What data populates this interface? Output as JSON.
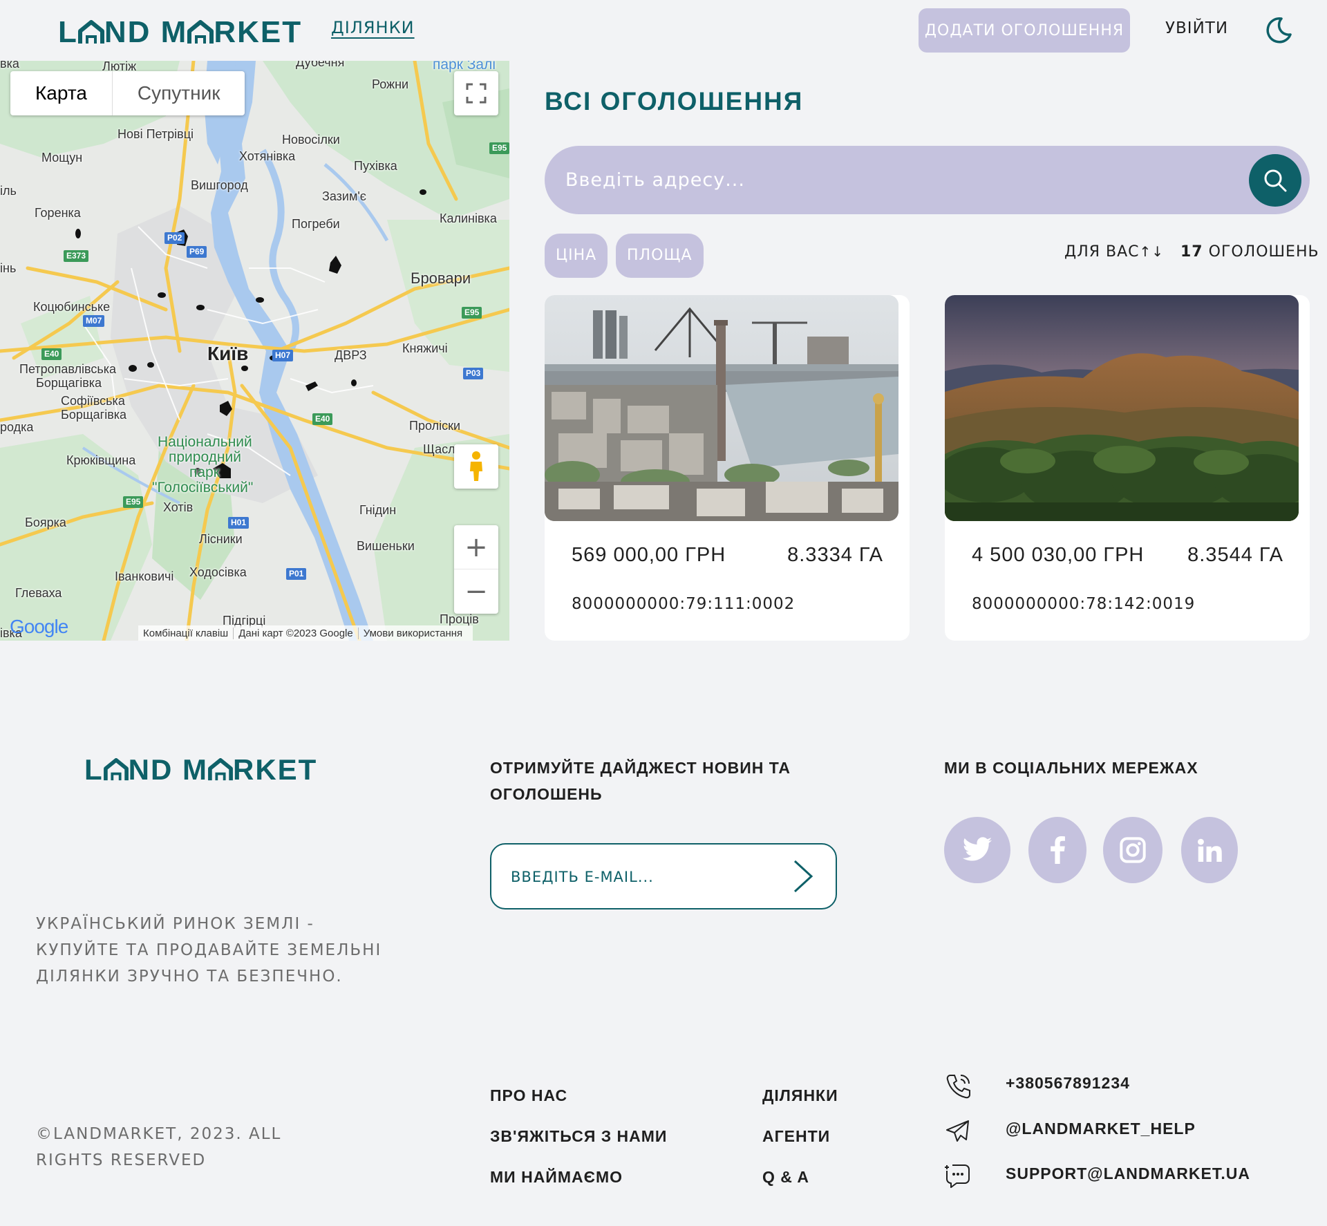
{
  "brand": {
    "logo_left": "L",
    "logo_mid1": "ND M",
    "logo_right": "RKET",
    "color_primary": "#0e6068",
    "color_accent": "#c5c2de"
  },
  "header": {
    "nav_plots": "ДІЛЯНКИ",
    "add_listing": "ДОДАТИ ОГОЛОШЕННЯ",
    "login": "УВІЙТИ",
    "theme_icon": "moon-icon"
  },
  "map": {
    "type_map": "Карта",
    "type_satellite": "Супутник",
    "zoom_in": "+",
    "zoom_out": "−",
    "labels": {
      "kyiv": "Київ",
      "brovary": "Бровари",
      "lyutizh": "Лютіж",
      "dubechnia": "Дубечня",
      "park": "парк Залі",
      "rozhny": "Рожни",
      "novi_petrivtsi": "Нові Петрівці",
      "novosilky": "Новосілки",
      "khotianivka": "Хотянівка",
      "moshchun": "Мощун",
      "pukhivka": "Пухівка",
      "vyshhorod": "Вишгород",
      "zazymie": "Зазим'є",
      "horenka": "Горенка",
      "pohreby": "Погреби",
      "kalynivka": "Калинівка",
      "kotsiubynske": "Коцюбинське",
      "petropavlivska": "Петропавлівська",
      "borshchahivka1": "Борщагівка",
      "sofiivska": "Софіївська",
      "borshchahivka2": "Борщагівка",
      "dvrz": "ДВРЗ",
      "kniazhychi": "Княжичі",
      "prolisky": "Проліски",
      "shchaslyve": "Щасл",
      "kriukivshchyna": "Крюківщина",
      "np1": "Національний",
      "np2": "природний",
      "np3": "парк",
      "np4": "\"Голосіївський\"",
      "khotiv": "Хотів",
      "hnidyn": "Гнідин",
      "boiarka": "Боярка",
      "lisnyky": "Лісники",
      "vyshenky": "Вишеньки",
      "hlevakha": "Глеваха",
      "ivankovychi": "Іванковичі",
      "khodosivka": "Ходосівка",
      "pidhirtsi": "Підгірці",
      "protsiv": "Проців",
      "edge_vka": "вка",
      "edge_il": "іль",
      "edge_in": "інь",
      "edge_rodka": "родка",
      "edge_vka2": "івка"
    },
    "roads": {
      "e95a": "E95",
      "e95b": "E95",
      "e95c": "E95",
      "e373": "E373",
      "m07": "M07",
      "e40a": "E40",
      "e40b": "E40",
      "p69": "P69",
      "p02": "P02",
      "h07": "H07",
      "p03": "P03",
      "h01": "H01",
      "p01": "P01"
    },
    "google": "Google",
    "footer_keys": "Комбінації клавіш",
    "footer_data": "Дані карт ©2023 Google",
    "footer_terms": "Умови використання"
  },
  "listings": {
    "title": "ВСІ ОГОЛОШЕННЯ",
    "search_placeholder": "Введіть адресу...",
    "filter_price": "ЦІНА",
    "filter_area": "ПЛОЩА",
    "sort_label": "ДЛЯ ВАС",
    "sort_icon": "↑↓",
    "count_number": "17",
    "count_label": "ОГОЛОШЕНЬ",
    "cards": [
      {
        "price": "569 000,00 ГРН",
        "area": "8.3334 ГА",
        "cadastral": "8000000000:79:111:0002",
        "photo": "city-panorama-photo"
      },
      {
        "price": "4 500 030,00 ГРН",
        "area": "8.3544 ГА",
        "cadastral": "8000000000:78:142:0019",
        "photo": "mountain-sunset-photo"
      }
    ]
  },
  "footer": {
    "tagline": "УКРАЇНСЬКИЙ РИНОК ЗЕМЛІ - КУПУЙТЕ ТА ПРОДАВАЙТЕ ЗЕМЕЛЬНІ ДІЛЯНКИ ЗРУЧНО ТА БЕЗПЕЧНО.",
    "copyright": "©LANDMARKET, 2023. ALL RIGHTS RESERVED",
    "digest_title": "ОТРИМУЙТЕ ДАЙДЖЕСТ НОВИН ТА ОГОЛОШЕНЬ",
    "email_placeholder": "ВВЕДІТЬ E-MAIL...",
    "social_title": "МИ В СОЦІАЛЬНИХ МЕРЕЖАХ",
    "social_icons": [
      "twitter-icon",
      "facebook-icon",
      "instagram-icon",
      "linkedin-icon"
    ],
    "links_col1": [
      "ПРО НАС",
      "ЗВ'ЯЖІТЬСЯ З НАМИ",
      "МИ НАЙМАЄМО"
    ],
    "links_col2": [
      "ДІЛЯНКИ",
      "АГЕНТИ",
      "Q & A"
    ],
    "phone": "+380567891234",
    "telegram": "@LANDMARKET_HELP",
    "email": "SUPPORT@LANDMARKET.UA"
  }
}
